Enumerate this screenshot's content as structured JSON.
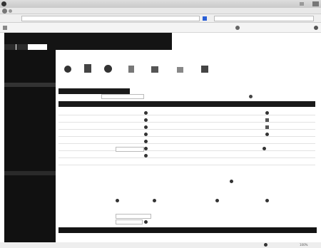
{
  "colors": {
    "sidebar": "#111111",
    "bar": "#141414",
    "accent": "#2a5fd6",
    "header": "#1a1a1a"
  },
  "browser": {
    "title": "",
    "menu": [],
    "address": "",
    "bookmarks": []
  },
  "app": {
    "sidebar_title": "",
    "sidebar_items": [],
    "toolbar": [],
    "panel_title": "",
    "form_labels": [],
    "footer_title": ""
  },
  "status": {
    "zoom": "100%"
  }
}
